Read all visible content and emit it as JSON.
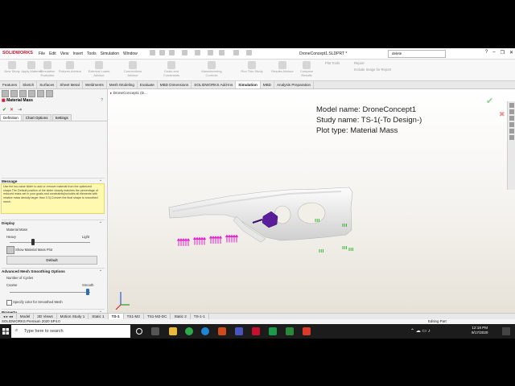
{
  "app": {
    "logo": "SOLIDWORKS",
    "menu": [
      "File",
      "Edit",
      "View",
      "Insert",
      "Tools",
      "Simulation",
      "Window"
    ],
    "document_title": "DroneConcept1.SLDPRT *",
    "search_value": "delete",
    "window_controls": [
      "?",
      "–",
      "❐",
      "✕"
    ]
  },
  "ribbon": {
    "buttons": [
      "New Study",
      "Apply Material",
      "Simulation Evaluator",
      "Fixtures Advisor",
      "External Loads Advisor",
      "Connections Advisor",
      "Goals and Constraints",
      "Manufacturing Controls",
      "Run This Study",
      "Results Advisor",
      "Compare Results"
    ],
    "plot_tools": "Plot Tools",
    "report": "Report",
    "include_image": "Include Image for Report"
  },
  "command_tabs": {
    "items": [
      "Features",
      "Sketch",
      "Surfaces",
      "Sheet Metal",
      "Weldments",
      "Mesh Modeling",
      "Evaluate",
      "MBD Dimensions",
      "SOLIDWORKS Add-Ins",
      "Simulation",
      "MBD",
      "Analysis Preparation"
    ],
    "active": "Simulation"
  },
  "property_manager": {
    "title": "Material Mass",
    "help": "?",
    "ok": "✔",
    "cancel": "✕",
    "pin": "⇥",
    "tabs": [
      "Definition",
      "Chart Options",
      "Settings"
    ],
    "message_header": "Message",
    "message_text": "Use the iso-value slider to add or remove material from the optimized shape.The Default position of the slider closely matches the percentage of reduced mass set in your goals and constraints(includes all elements with relative mass density larger than 0.3).Convert the final shape to smoothed mesh.",
    "display_header": "Display",
    "material_mass_label": "Material Mass",
    "heavy_label": "Heavy",
    "light_label": "Light",
    "material_mass_level": 0.29,
    "show_plot_label": "Show Material Mass Plot",
    "default_button": "Default",
    "smoothing_header": "Advanced Mesh Smoothing Options",
    "cycles_label": "Number of Cycles",
    "coarse_label": "Coarse",
    "smooth_label": "Smooth",
    "smoothing_level": 0.97,
    "specify_color_label": "Specify color for Smoothed Mesh",
    "property_header": "Property"
  },
  "viewport": {
    "tree_label": "DroneConcept1 (D...",
    "model_name": "Model name: DroneConcept1",
    "study_name": "Study name: TS-1(-To Design-)",
    "plot_type": "Plot type: Material Mass"
  },
  "bottom_tabs": {
    "items": [
      "Model",
      "3D Views",
      "Motion Study 1",
      "Static 1",
      "TS-1",
      "TS1-M2",
      "TS1-M2-DC",
      "Static 2",
      "TS-1-1"
    ],
    "active": "TS-1"
  },
  "status": {
    "left": "SOLIDWORKS Premium 2020 SP4.0",
    "right": "Editing Part"
  },
  "taskbar": {
    "search_placeholder": "Type here to search",
    "time": "12:18 PM",
    "date": "9/17/2020"
  },
  "colors": {
    "accent_red": "#c8102e",
    "message_bg": "#fff9b0",
    "force_arrows": "#e81ecf",
    "fixture_arrows": "#22b022",
    "connector": "#5a1e9a",
    "model_shade": "#efefef"
  }
}
